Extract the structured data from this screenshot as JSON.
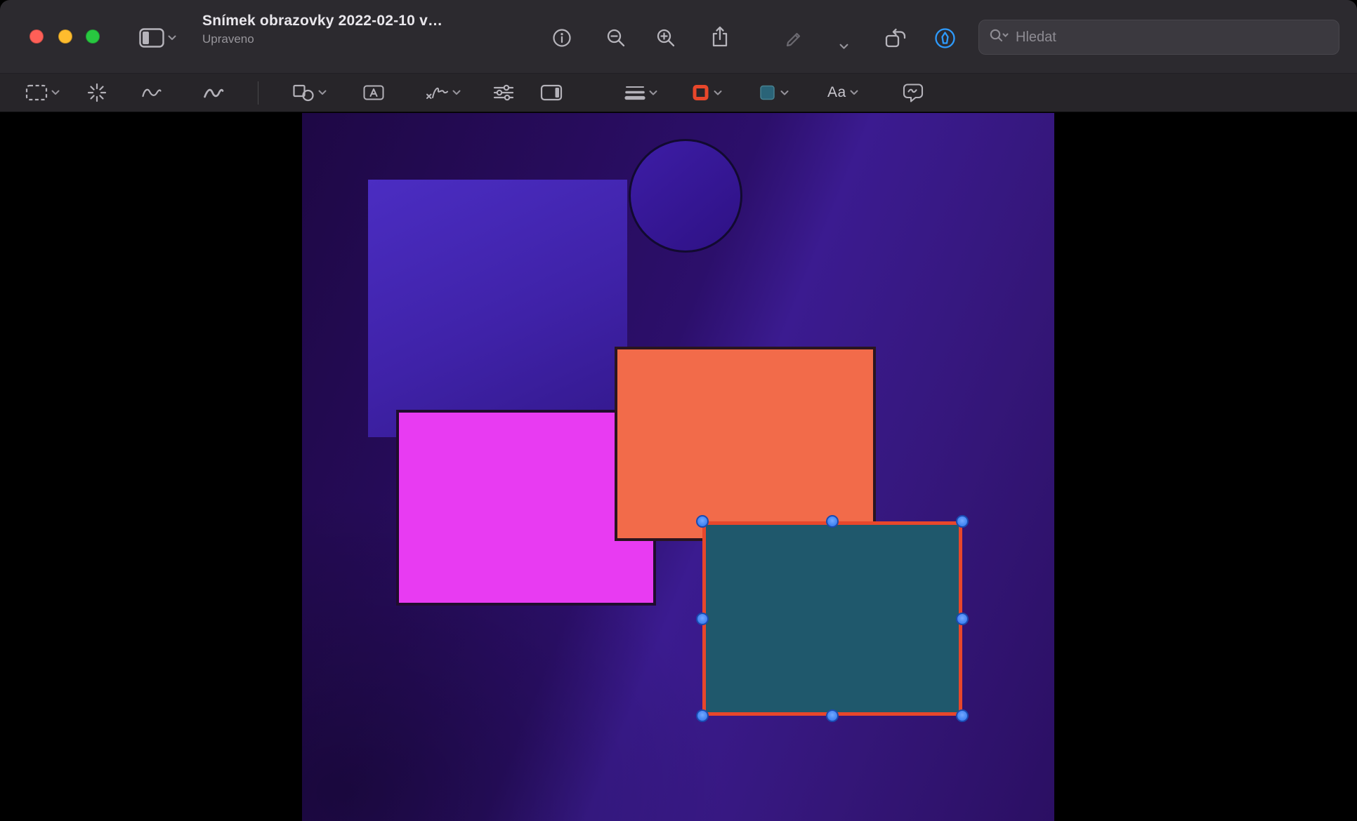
{
  "window": {
    "title": "Snímek obrazovky 2022-02-10 v…",
    "subtitle": "Upraveno"
  },
  "titlebar": {
    "traffic_lights": [
      "close",
      "minimize",
      "zoom"
    ],
    "search": {
      "placeholder": "Hledat"
    },
    "buttons": [
      "sidebar-toggle",
      "info",
      "zoom-out",
      "zoom-in",
      "share",
      "markup-pen",
      "markup-pen-menu",
      "rotate-left",
      "markup-toolbar-toggle"
    ]
  },
  "markup_toolbar": {
    "buttons": [
      "selection-tool",
      "instant-alpha",
      "sketch",
      "draw",
      "shapes",
      "text-box",
      "sign",
      "adjust",
      "crop",
      "line-style",
      "border-color",
      "fill-color",
      "text-style",
      "describe"
    ],
    "text_style_label": "Aa"
  },
  "colors": {
    "accent_blue": "#2E9BFF",
    "border_red": "#E8472B",
    "fill_teal": "#1F586C",
    "traffic_close": "#FF5F57",
    "traffic_minimize": "#FEBC2E",
    "traffic_zoom": "#28C840",
    "chrome": "#2C2A2F",
    "canvas_background": "#2C0F6B"
  },
  "canvas": {
    "shapes": [
      {
        "name": "indigo-square",
        "fill": "#4B2DC2"
      },
      {
        "name": "indigo-circle",
        "fill": "#3D1DA6",
        "stroke": "#120A30"
      },
      {
        "name": "magenta-rectangle",
        "fill": "#E83BF2",
        "stroke": "#1F0D2E"
      },
      {
        "name": "orange-rectangle",
        "fill": "#F26B4A",
        "stroke": "#2A1520"
      },
      {
        "name": "teal-rectangle",
        "fill": "#1F586C",
        "stroke": "#E8472B",
        "selected": true,
        "handles": 8
      }
    ]
  }
}
